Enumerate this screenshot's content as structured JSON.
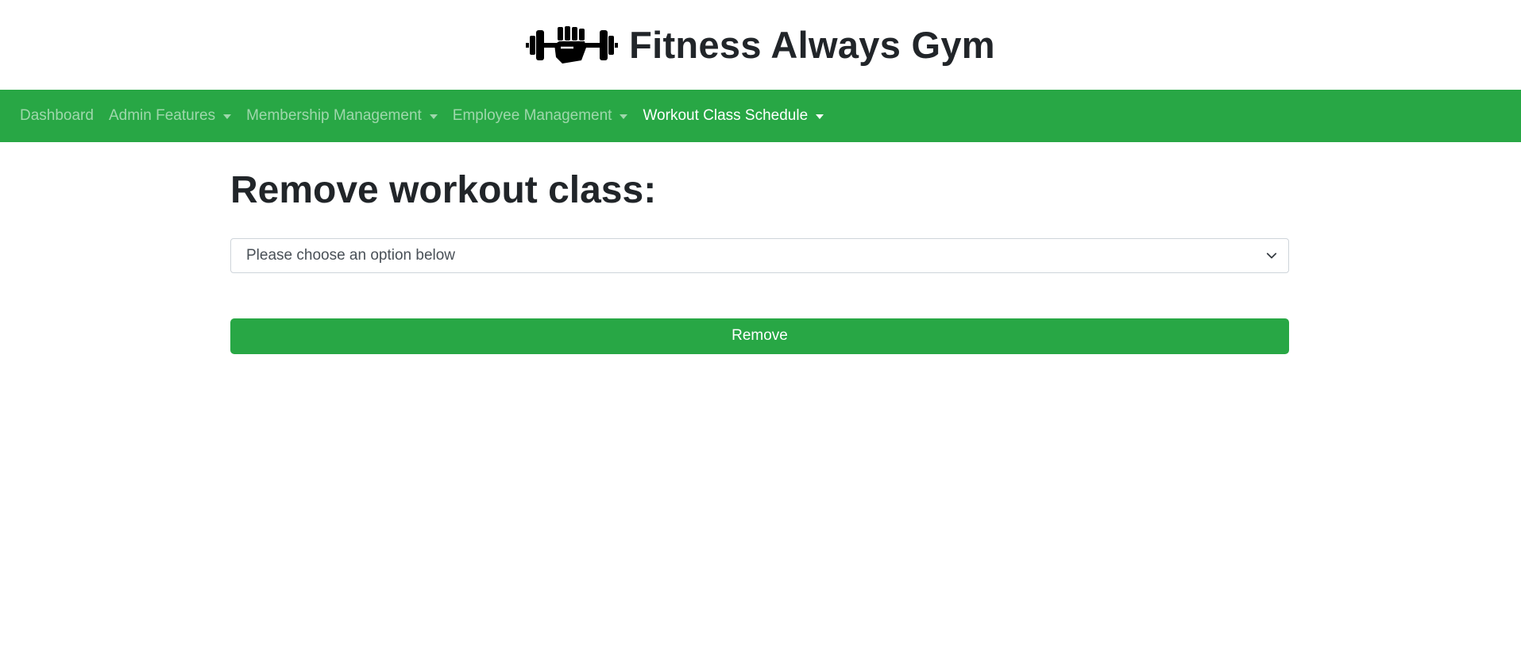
{
  "brand": {
    "title": "Fitness Always Gym",
    "logo_icon": "dumbbell-fist-icon"
  },
  "navbar": {
    "background_color": "#28a745",
    "items": [
      {
        "label": "Dashboard",
        "dropdown": false,
        "active": false
      },
      {
        "label": "Admin Features",
        "dropdown": true,
        "active": false
      },
      {
        "label": "Membership Management",
        "dropdown": true,
        "active": false
      },
      {
        "label": "Employee Management",
        "dropdown": true,
        "active": false
      },
      {
        "label": "Workout Class Schedule",
        "dropdown": true,
        "active": true
      }
    ]
  },
  "main": {
    "title": "Remove workout class:",
    "select": {
      "selected": "Please choose an option below",
      "icon": "chevron-down-icon"
    },
    "remove_button_label": "Remove",
    "button_color": "#28a745"
  }
}
